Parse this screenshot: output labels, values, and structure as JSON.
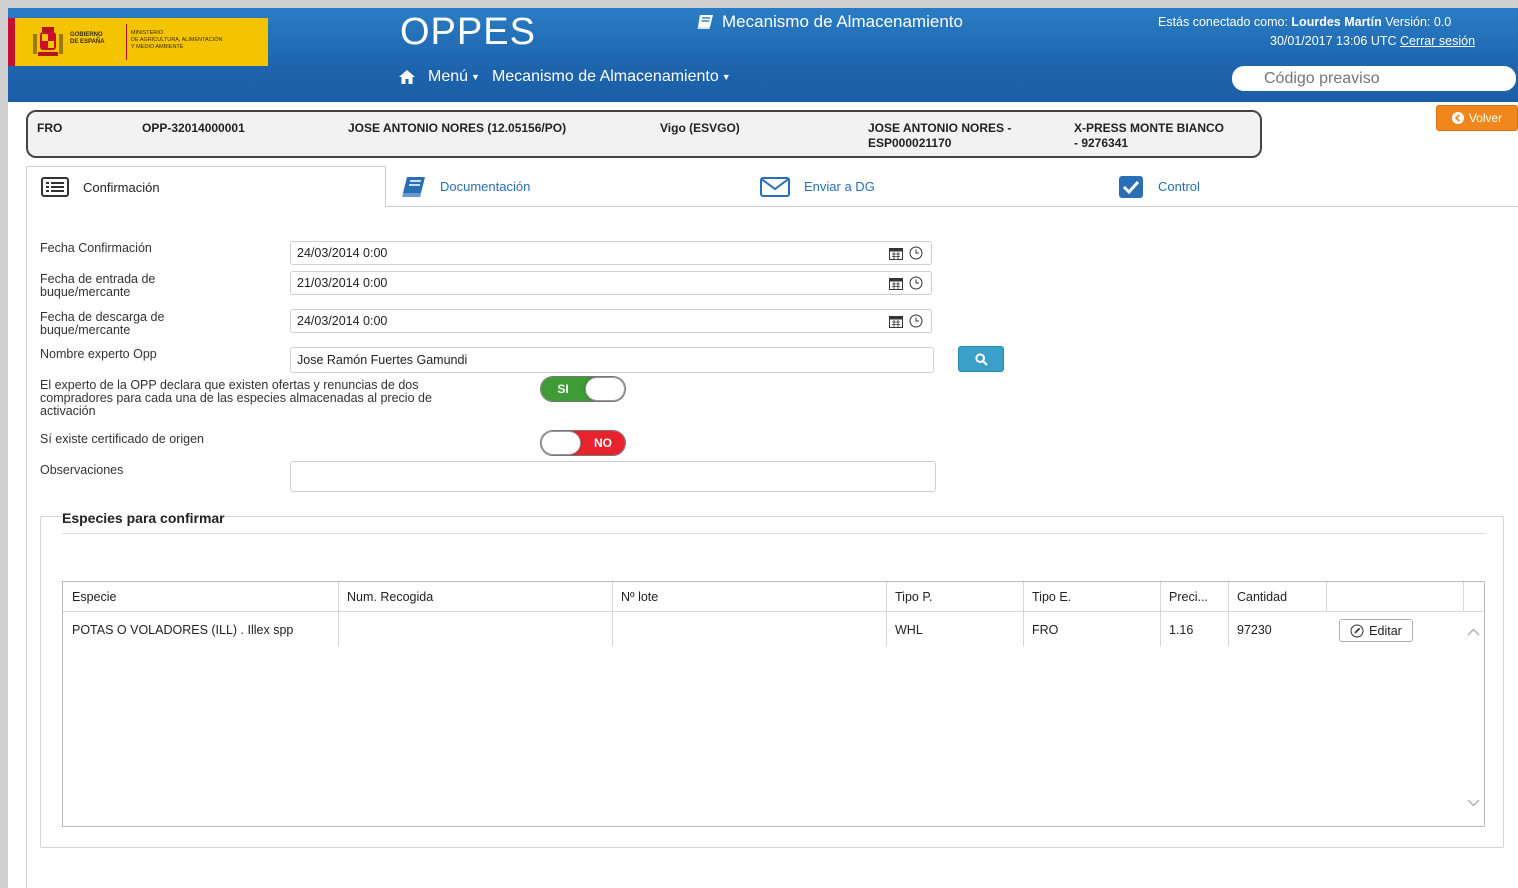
{
  "header": {
    "logo": {
      "gobierno_line1": "GOBIERNO",
      "gobierno_line2": "DE ESPAÑA",
      "ministerio_line1": "MINISTERIO",
      "ministerio_line2": "DE AGRICULTURA, ALIMENTACIÓN",
      "ministerio_line3": "Y MEDIO AMBIENTE"
    },
    "app_name": "OPPES",
    "module_title": "Mecanismo de Almacenamiento",
    "user": {
      "connected_prefix": "Estás conectado como:",
      "user_name": "Lourdes Martín",
      "version_label": "Versión: 0.0",
      "datetime": "30/01/2017 13:06",
      "timezone": "UTC",
      "logout_label": "Cerrar sesión"
    },
    "nav": {
      "menu_label": "Menú",
      "module_menu_label": "Mecanismo de Almacenamiento"
    },
    "search": {
      "placeholder": "Código preaviso"
    }
  },
  "info_strip": {
    "estado": "FRO",
    "codigo": "OPP-32014000001",
    "titular": "JOSE ANTONIO NORES (12.05156/PO)",
    "puerto": "Vigo (ESVGO)",
    "buque_line1": "JOSE ANTONIO NORES -",
    "buque_line2": "ESP000021170",
    "mercante_line1": "X-PRESS MONTE BIANCO",
    "mercante_line2": "- 9276341"
  },
  "volver_label": "Volver",
  "tabs": [
    {
      "label": "Confirmación",
      "icon": "list-icon"
    },
    {
      "label": "Documentación",
      "icon": "book-icon"
    },
    {
      "label": "Enviar a DG",
      "icon": "envelope-icon"
    },
    {
      "label": "Control",
      "icon": "checkbox-icon"
    }
  ],
  "form": {
    "fecha_confirmacion": {
      "label": "Fecha Confirmación",
      "value": "24/03/2014 0:00"
    },
    "fecha_entrada": {
      "label_line1": "Fecha de entrada de",
      "label_line2": "buque/mercante",
      "value": "21/03/2014 0:00"
    },
    "fecha_descarga": {
      "label_line1": "Fecha de descarga de",
      "label_line2": "buque/mercante",
      "value": "24/03/2014 0:00"
    },
    "experto": {
      "label": "Nombre experto Opp",
      "value": "Jose Ramón Fuertes Gamundi"
    },
    "declaracion": {
      "label_line1": "El experto de la OPP declara que existen ofertas y renuncias de dos",
      "label_line2": "compradores para cada una de las especies almacenadas al precio de",
      "label_line3": "activación",
      "toggle_label": "SI"
    },
    "certificado": {
      "label": "Sí existe certificado de origen",
      "toggle_label": "NO"
    },
    "observaciones": {
      "label": "Observaciones",
      "value": ""
    }
  },
  "species": {
    "title": "Especies para confirmar",
    "columns": [
      "Especie",
      "Num. Recogida",
      "Nº lote",
      "Tipo P.",
      "Tipo E.",
      "Preci...",
      "Cantidad"
    ],
    "rows": [
      {
        "especie": "POTAS O VOLADORES (ILL) . Illex spp",
        "num_recogida": "",
        "lote": "",
        "tipo_p": "WHL",
        "tipo_e": "FRO",
        "precio": "1.16",
        "cantidad": "97230",
        "edit_label": "Editar"
      }
    ]
  },
  "colors": {
    "header_blue": "#1d64ad",
    "toggle_green": "#3f9b35",
    "toggle_red": "#e8232e",
    "volver_orange": "#f0871c",
    "search_button": "#3aa0c8",
    "tab_link": "#2a6eb8"
  }
}
